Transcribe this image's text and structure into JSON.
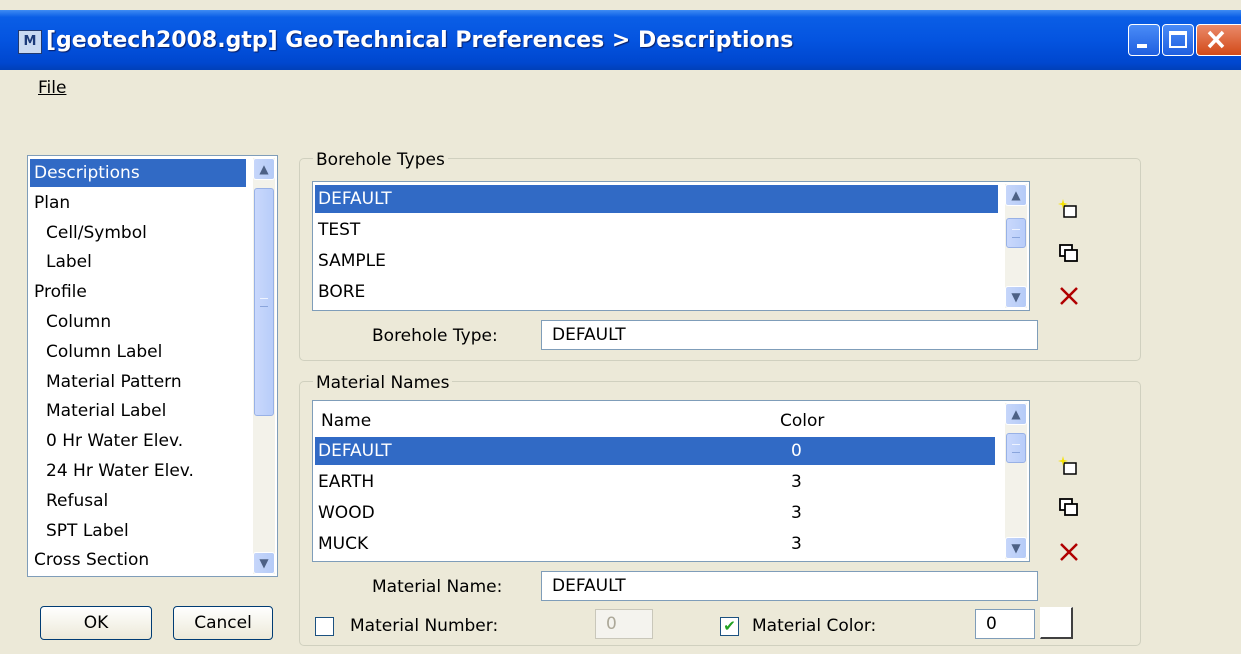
{
  "window": {
    "title": "[geotech2008.gtp] GeoTechnical Preferences > Descriptions"
  },
  "menu": {
    "file": "File"
  },
  "nav": {
    "items": [
      {
        "label": "Descriptions",
        "indent": 0,
        "selected": true
      },
      {
        "label": "Plan",
        "indent": 0
      },
      {
        "label": "Cell/Symbol",
        "indent": 1
      },
      {
        "label": "Label",
        "indent": 1
      },
      {
        "label": "Profile",
        "indent": 0
      },
      {
        "label": "Column",
        "indent": 1
      },
      {
        "label": "Column Label",
        "indent": 1
      },
      {
        "label": "Material Pattern",
        "indent": 1
      },
      {
        "label": "Material Label",
        "indent": 1
      },
      {
        "label": "0 Hr Water Elev.",
        "indent": 1
      },
      {
        "label": "24 Hr Water Elev.",
        "indent": 1
      },
      {
        "label": "Refusal",
        "indent": 1
      },
      {
        "label": "SPT Label",
        "indent": 1
      },
      {
        "label": "Cross Section",
        "indent": 0
      }
    ]
  },
  "buttons": {
    "ok": "OK",
    "cancel": "Cancel"
  },
  "borehole": {
    "group_title": "Borehole Types",
    "items": [
      "DEFAULT",
      "TEST",
      "SAMPLE",
      "BORE"
    ],
    "field_label": "Borehole Type:",
    "field_value": "DEFAULT"
  },
  "material": {
    "group_title": "Material Names",
    "col_name": "Name",
    "col_color": "Color",
    "rows": [
      {
        "name": "DEFAULT",
        "color": "0"
      },
      {
        "name": "EARTH",
        "color": "3"
      },
      {
        "name": "WOOD",
        "color": "3"
      },
      {
        "name": "MUCK",
        "color": "3"
      }
    ],
    "name_label": "Material Name:",
    "name_value": "DEFAULT",
    "number_label": "Material Number:",
    "number_value": "0",
    "number_checked": false,
    "color_label": "Material Color:",
    "color_value": "0",
    "color_checked": true
  },
  "colors": {
    "selection": "#316ac5",
    "titlebar": "#0454e0",
    "delete_icon": "#b00000"
  }
}
